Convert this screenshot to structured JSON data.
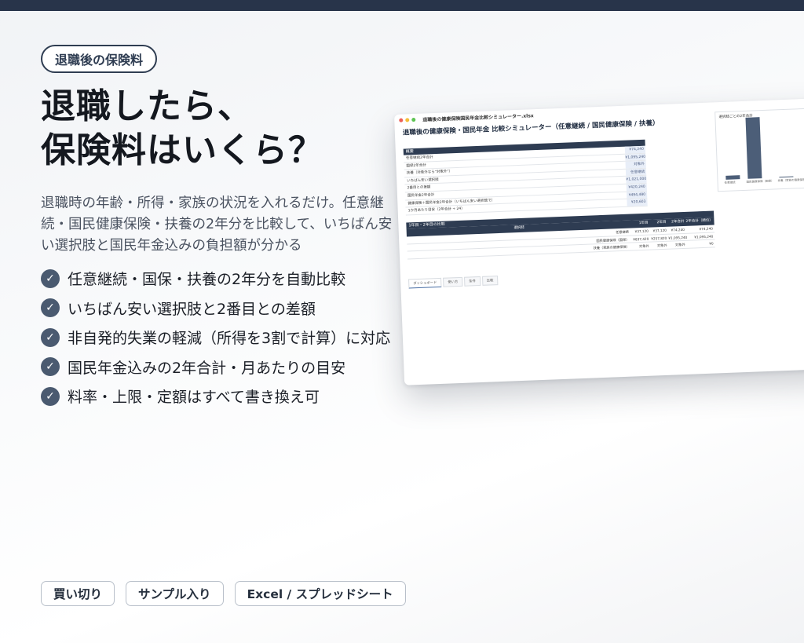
{
  "badge": "退職後の保険料",
  "title": [
    "退職したら、",
    "保険料はいくら？"
  ],
  "description": "退職時の年齢・所得・家族の状況を入れるだけ。任意継続・国民健康保険・扶養の2年分を比較して、いちばん安い選択肢と国民年金込みの負担額が分かる",
  "features": [
    "任意継続・国保・扶養の2年分を自動比較",
    "いちばん安い選択肢と2番目との差額",
    "非自発的失業の軽減（所得を3割で計算）に対応",
    "国民年金込みの2年合計・月あたりの目安",
    "料率・上限・定額はすべて書き換え可"
  ],
  "tags": [
    "買い切り",
    "サンプル入り",
    "Excel / スプレッドシート"
  ],
  "check_icon": "✓",
  "colors": {
    "top_bar": "#28344a",
    "accent": "#4a5a70",
    "table_header": "#2e3c52"
  },
  "screenshot": {
    "window_title": "退職後の健康保険国民年金比較シミュレーター.xlsx",
    "sheet_title": "退職後の健康保険・国民年金 比較シミュレーター（任意継続 / 国民健康保険 / 扶養）",
    "summary": {
      "header": "概要",
      "rows": [
        {
          "label": "任意継続2年合計",
          "value": "¥74,240"
        },
        {
          "label": "国保2年合計",
          "value": "¥1,095,240"
        },
        {
          "label": "扶養（対象外なら\"対象外\"）",
          "value": "対象外"
        },
        {
          "label": "いちばん安い選択肢",
          "value": "任意継続"
        },
        {
          "label": "2番目との差額",
          "value": "¥1,021,000"
        },
        {
          "label": "国民年金2年合計",
          "value": "¥420,240"
        },
        {
          "label": "健康保険＋国民年金2年合計（いちばん安い選択肢で）",
          "value": "¥494,480"
        },
        {
          "label": "1か月あたり目安（2年合計 ÷ 24）",
          "value": "¥20,603"
        }
      ]
    },
    "chart": {
      "title": "選択肢ごとの2年合計",
      "chart_data": {
        "type": "bar",
        "categories": [
          "任意継続",
          "国民健康保険（国保）",
          "扶養（家族の健康保険）"
        ],
        "values": [
          74240,
          1095240,
          0
        ]
      }
    },
    "comparison": {
      "header": "1年目・2年目の比較",
      "columns": [
        "選択肢",
        "1年目",
        "2年目",
        "2年合計",
        "2年合計（順位）"
      ],
      "rows": [
        [
          "任意継続",
          "¥37,120",
          "¥37,120",
          "¥74,240",
          "¥74,240"
        ],
        [
          "国民健康保険（国保）",
          "¥837,420",
          "¥257,820",
          "¥1,095,240",
          "¥1,095,240"
        ],
        [
          "扶養（家族の健康保険）",
          "対象外",
          "対象外",
          "対象外",
          "¥0"
        ]
      ]
    },
    "sheet_tabs": [
      "ダッシュボード",
      "使い方",
      "条件",
      "比較"
    ]
  }
}
